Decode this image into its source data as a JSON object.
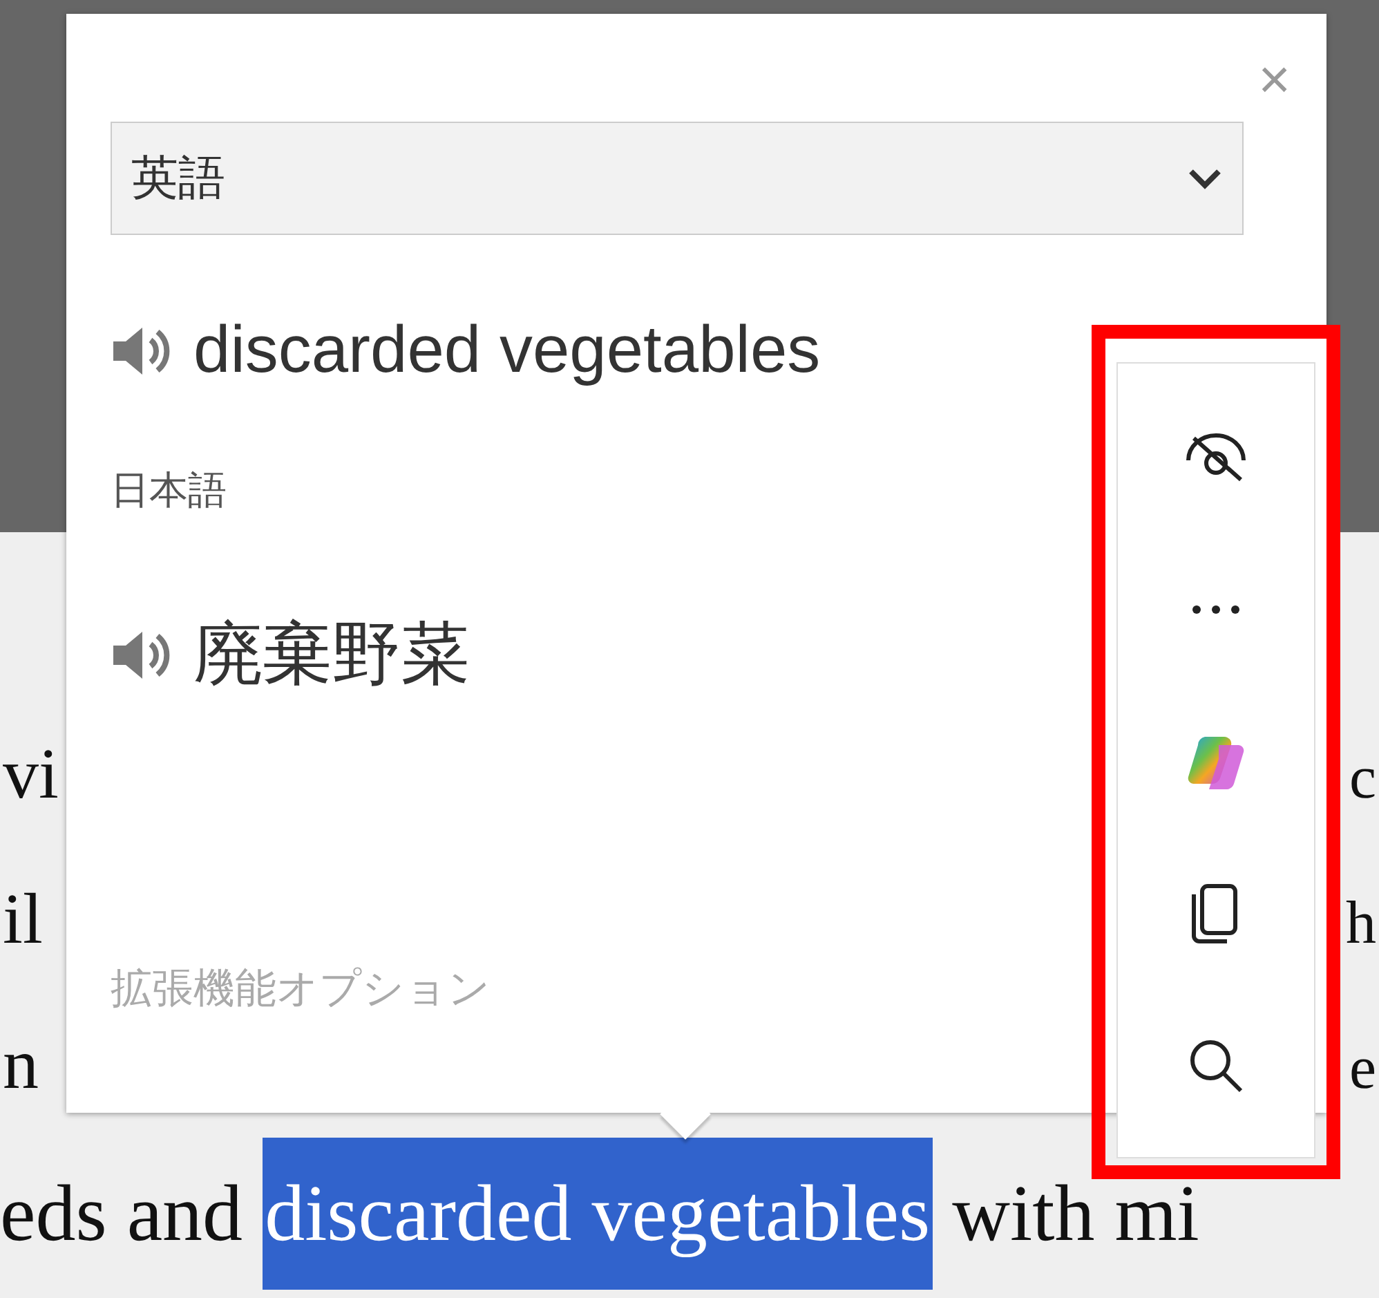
{
  "page": {
    "lines": [
      {
        "left": "vi",
        "right": "c"
      },
      {
        "left": "il",
        "right": "h"
      },
      {
        "left": "n",
        "right": "e"
      }
    ],
    "last_line": {
      "before": "eds and",
      "selected_text": "discarded vegetables",
      "after": "with mi"
    }
  },
  "popup": {
    "close": "×",
    "source_language": "英語",
    "source_text": "discarded vegetables",
    "target_language_label": "日本語",
    "translation": "廃棄野菜",
    "options_link": "拡張機能オプション"
  },
  "toolbar": {
    "highlighted": true,
    "buttons": [
      {
        "kind": "hide"
      },
      {
        "kind": "more"
      },
      {
        "kind": "copilot"
      },
      {
        "kind": "copy"
      },
      {
        "kind": "search"
      }
    ]
  }
}
